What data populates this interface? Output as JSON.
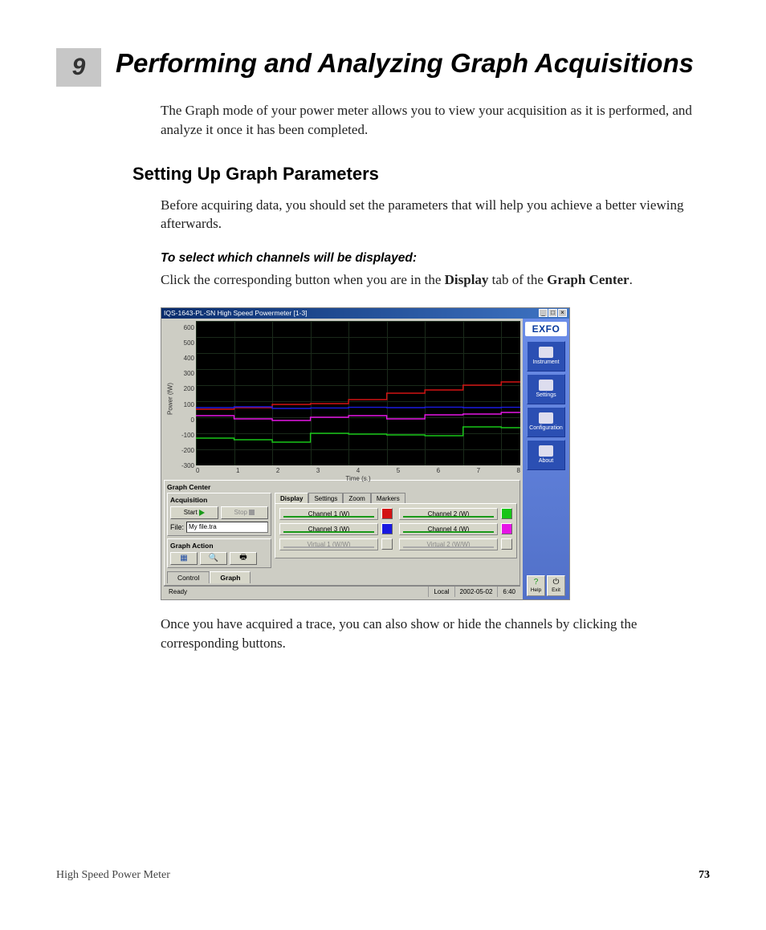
{
  "chapter": {
    "number": "9",
    "title": "Performing and Analyzing Graph Acquisitions"
  },
  "intro": "The Graph mode of your power meter allows you to view your acquisition as it is performed, and analyze it once it has been completed.",
  "section_heading": "Setting Up Graph Parameters",
  "section_intro": "Before acquiring data, you should set the parameters that will help you achieve a better viewing afterwards.",
  "proc_heading": "To select which channels will be displayed:",
  "proc_body_pre": "Click the corresponding button when you are in the ",
  "proc_body_bold1": "Display",
  "proc_body_mid": " tab of the ",
  "proc_body_bold2": "Graph Center",
  "proc_body_post": ".",
  "after_screenshot": "Once you have acquired a trace, you can also show or hide the channels by clicking the corresponding buttons.",
  "footer": {
    "left": "High Speed Power Meter",
    "page": "73"
  },
  "app": {
    "title": "IQS-1643-PL-SN High Speed Powermeter [1-3]",
    "logo": "EXFO",
    "side_buttons": [
      {
        "label": "Instrument"
      },
      {
        "label": "Settings"
      },
      {
        "label": "Configuration"
      },
      {
        "label": "About"
      }
    ],
    "side_foot": {
      "help": "Help",
      "exit": "Exit"
    },
    "graph_center_label": "Graph Center",
    "acq": {
      "label": "Acquisition",
      "start": "Start",
      "stop": "Stop",
      "file_label": "File:",
      "file_value": "My file.tra"
    },
    "graph_action_label": "Graph Action",
    "tabs": [
      "Display",
      "Settings",
      "Zoom",
      "Markers"
    ],
    "channels": [
      {
        "label": "Channel 1 (W)",
        "color": "#d31313"
      },
      {
        "label": "Channel 2 (W)",
        "color": "#18c518"
      },
      {
        "label": "Channel 3 (W)",
        "color": "#1a1ae0"
      },
      {
        "label": "Channel 4 (W)",
        "color": "#e615e6"
      },
      {
        "label": "Virtual 1 (W/W)",
        "color": "#cccccc",
        "disabled": true
      },
      {
        "label": "Virtual 2 (W/W)",
        "color": "#cccccc",
        "disabled": true
      }
    ],
    "bottom_tabs": {
      "control": "Control",
      "graph": "Graph"
    },
    "status": {
      "ready": "Ready",
      "mode": "Local",
      "date": "2002-05-02",
      "time": "6:40"
    }
  },
  "chart_data": {
    "type": "line",
    "xlabel": "Time (s.)",
    "ylabel": "Power (fW)",
    "x_ticks": [
      "0",
      "1",
      "2",
      "3",
      "4",
      "5",
      "6",
      "7",
      "8"
    ],
    "y_ticks": [
      "600",
      "500",
      "400",
      "300",
      "200",
      "100",
      "0",
      "-100",
      "-200",
      "-300"
    ],
    "xlim": [
      0,
      8.5
    ],
    "ylim": [
      -300,
      600
    ],
    "series": [
      {
        "name": "Channel 1 (W)",
        "color": "#d31313",
        "values": [
          [
            0,
            50
          ],
          [
            1,
            50
          ],
          [
            1,
            60
          ],
          [
            2,
            60
          ],
          [
            2,
            80
          ],
          [
            3,
            80
          ],
          [
            3,
            85
          ],
          [
            4,
            85
          ],
          [
            4,
            110
          ],
          [
            5,
            110
          ],
          [
            5,
            150
          ],
          [
            6,
            150
          ],
          [
            6,
            170
          ],
          [
            7,
            170
          ],
          [
            7,
            200
          ],
          [
            8,
            200
          ],
          [
            8,
            220
          ],
          [
            8.5,
            220
          ]
        ]
      },
      {
        "name": "Channel 2 (W)",
        "color": "#18c518",
        "values": [
          [
            0,
            -130
          ],
          [
            1,
            -130
          ],
          [
            1,
            -140
          ],
          [
            2,
            -140
          ],
          [
            2,
            -155
          ],
          [
            3,
            -155
          ],
          [
            3,
            -100
          ],
          [
            4,
            -100
          ],
          [
            4,
            -105
          ],
          [
            5,
            -105
          ],
          [
            5,
            -110
          ],
          [
            6,
            -110
          ],
          [
            6,
            -115
          ],
          [
            7,
            -115
          ],
          [
            7,
            -60
          ],
          [
            8,
            -60
          ],
          [
            8,
            -65
          ],
          [
            8.5,
            -65
          ]
        ]
      },
      {
        "name": "Channel 3 (W)",
        "color": "#1a1ae0",
        "values": [
          [
            0,
            60
          ],
          [
            1,
            60
          ],
          [
            1,
            65
          ],
          [
            2,
            65
          ],
          [
            2,
            55
          ],
          [
            3,
            55
          ],
          [
            3,
            58
          ],
          [
            4,
            58
          ],
          [
            4,
            62
          ],
          [
            5,
            62
          ],
          [
            5,
            60
          ],
          [
            6,
            60
          ],
          [
            6,
            63
          ],
          [
            7,
            63
          ],
          [
            7,
            60
          ],
          [
            8,
            60
          ],
          [
            8,
            62
          ],
          [
            8.5,
            62
          ]
        ]
      },
      {
        "name": "Channel 4 (W)",
        "color": "#e615e6",
        "values": [
          [
            0,
            10
          ],
          [
            1,
            10
          ],
          [
            1,
            -10
          ],
          [
            2,
            -10
          ],
          [
            2,
            -20
          ],
          [
            3,
            -20
          ],
          [
            3,
            0
          ],
          [
            4,
            0
          ],
          [
            4,
            10
          ],
          [
            5,
            10
          ],
          [
            5,
            -10
          ],
          [
            6,
            -10
          ],
          [
            6,
            15
          ],
          [
            7,
            15
          ],
          [
            7,
            20
          ],
          [
            8,
            20
          ],
          [
            8,
            30
          ],
          [
            8.5,
            30
          ]
        ]
      }
    ]
  }
}
